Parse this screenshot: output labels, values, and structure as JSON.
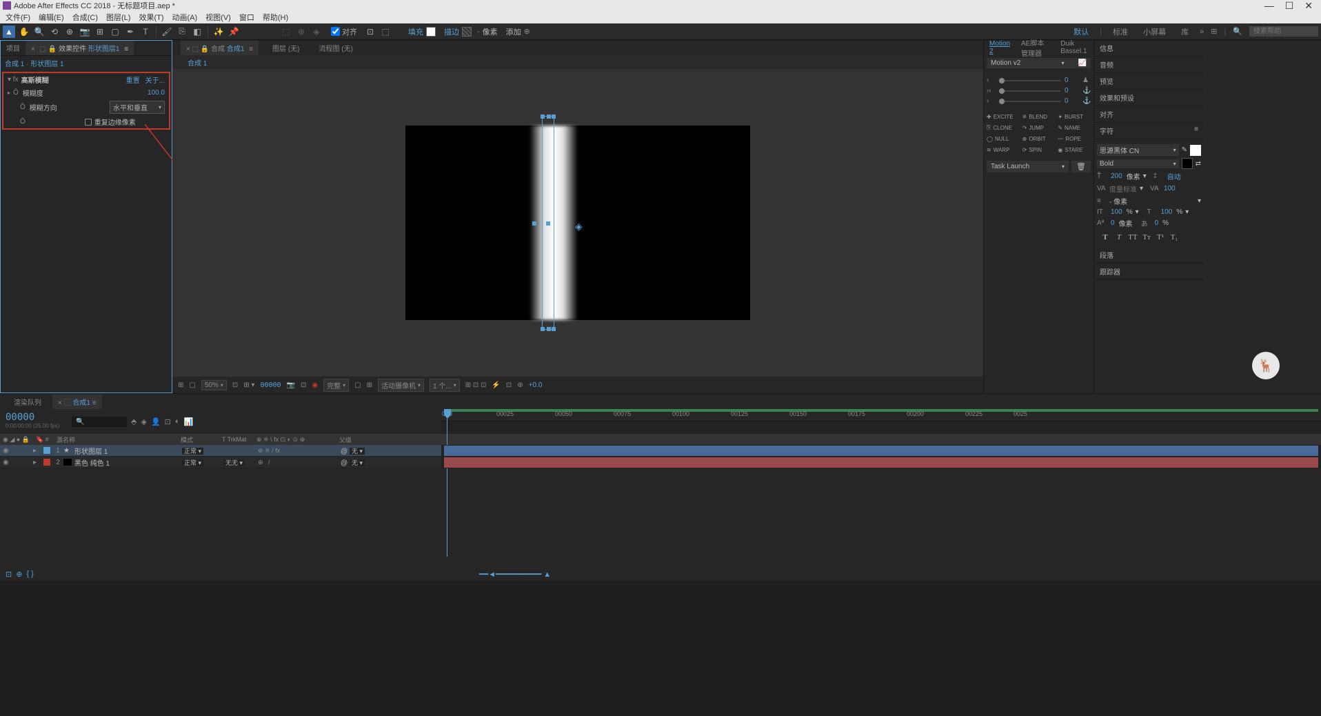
{
  "title": "Adobe After Effects CC 2018 - 无标题项目.aep *",
  "menu": [
    "文件(F)",
    "编辑(E)",
    "合成(C)",
    "图层(L)",
    "效果(T)",
    "动画(A)",
    "视图(V)",
    "窗口",
    "帮助(H)"
  ],
  "toolbar": {
    "snap": "对齐",
    "fill": "填充",
    "stroke": "描边",
    "px": "像素",
    "add": "添加"
  },
  "workspaces": {
    "default": "默认",
    "standard": "标准",
    "small": "小屏幕",
    "library": "库"
  },
  "search_placeholder": "搜索帮助",
  "left": {
    "tab_project": "项目",
    "tab_effect": "效果控件",
    "tab_effect_target": "形状图层1",
    "breadcrumb_comp": "合成 1",
    "breadcrumb_layer": "形状图层 1",
    "effect": {
      "name": "高斯模糊",
      "reset": "重置",
      "about": "关于...",
      "blurriness_label": "模糊度",
      "blurriness_value": "100.0",
      "dimensions_label": "模糊方向",
      "dimensions_value": "水平和垂直",
      "repeat_label": "重复边缘像素"
    }
  },
  "viewer": {
    "tab_comp_prefix": "合成",
    "tab_comp_name": "合成1",
    "tab_layer": "图层  (无)",
    "tab_flowchart": "流程图  (无)",
    "sub_tab": "合成 1",
    "footer": {
      "zoom": "50%",
      "timecode": "00000",
      "quality": "完整",
      "camera": "活动摄像机",
      "views": "1 个...",
      "exposure": "+0.0"
    }
  },
  "motion": {
    "tabs": {
      "m2": "Motion 2",
      "ae": "AE脚本管理器",
      "duik": "Duik Bassel.1"
    },
    "version": "Motion v2",
    "sliders": [
      {
        "icon": "‹",
        "value": "0"
      },
      {
        "icon": "›‹",
        "value": "0"
      },
      {
        "icon": "›",
        "value": "0"
      }
    ],
    "buttons": [
      "EXCITE",
      "BLEND",
      "BURST",
      "CLONE",
      "JUMP",
      "NAME",
      "NULL",
      "ORBIT",
      "ROPE",
      "WARP",
      "SPIN",
      "STARE"
    ],
    "task": "Task Launch"
  },
  "props": {
    "info": "信息",
    "audio": "音频",
    "preview": "预览",
    "presets": "效果和预设",
    "align": "对齐",
    "character": "字符",
    "paragraph": "段落",
    "tracker": "跟踪器",
    "font": "思源黑体 CN",
    "weight": "Bold",
    "size": "200",
    "size_unit": "像素",
    "leading": "自动",
    "tracking": "度量标准",
    "tracking_val": "100",
    "px_unit": "- 像素",
    "scale_v": "100",
    "scale_h": "100",
    "baseline": "0",
    "tsume": "0",
    "pct": "%"
  },
  "timeline": {
    "tab_render": "渲染队列",
    "tab_comp": "合成1",
    "timecode": "00000",
    "framerate": "0:00:00:00 (25.00 fps)",
    "cols": {
      "source": "源名称",
      "mode": "模式",
      "trkmat": "TrkMat",
      "parent": "父级"
    },
    "ruler": [
      "00025",
      "00050",
      "00075",
      "00100",
      "00125",
      "00150",
      "00175",
      "00200",
      "00225",
      "0025"
    ],
    "layers": [
      {
        "num": "1",
        "color": "#5a9fd4",
        "name": "形状图层  1",
        "mode": "正常",
        "trk": "",
        "parent": "无",
        "selected": true,
        "star": true
      },
      {
        "num": "2",
        "color": "#c0392b",
        "name": "黑色 纯色 1",
        "mode": "正常",
        "trk": "无",
        "parent": "无",
        "selected": false,
        "star": false
      }
    ],
    "mode_none": "无"
  }
}
